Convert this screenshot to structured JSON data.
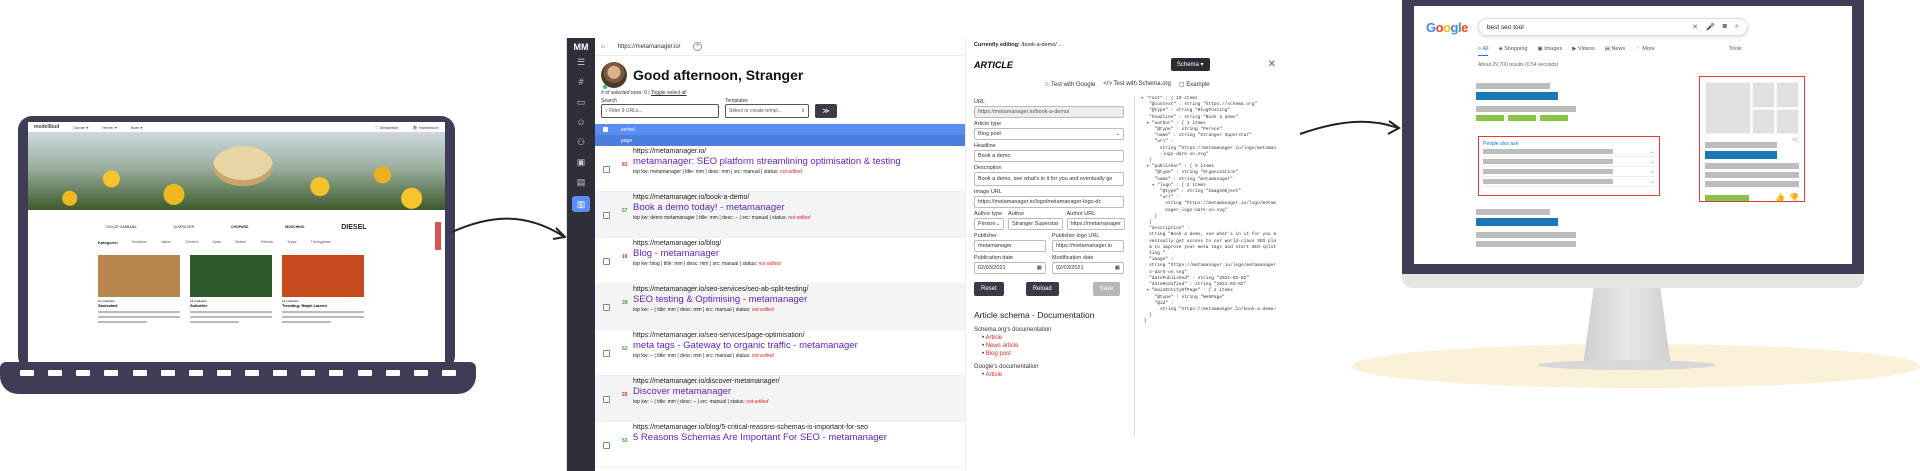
{
  "shop": {
    "logo": "modellbud",
    "nav": [
      "Damer ▾",
      "Herrer ▾",
      "Barn ▾"
    ],
    "actions": [
      "♡ Ønskeliste",
      "🛍 Handlekurv"
    ],
    "brands": [
      "DOLCE·GABBANA",
      "QUIKSILVER",
      "CHOPARD",
      "MOSCHINO",
      "DIESEL"
    ],
    "categories_title": "Kategorier",
    "categories": [
      "Sneakers",
      "Jakker",
      "Gensere",
      "Kjoler",
      "Bukser",
      "Tilbehør",
      "Toppe",
      "Treningsklær"
    ],
    "cards": [
      {
        "tag": "10 produkter",
        "title": "Skolestart",
        "color": "#b8864b"
      },
      {
        "tag": "15 produkter",
        "title": "Solbriller",
        "color": "#2e5a2a"
      },
      {
        "tag": "12 produkter",
        "title": "Trending: Ralph Lauren",
        "color": "#c4491c"
      }
    ]
  },
  "app": {
    "logo": "MM",
    "url": "https://metamanager.io/",
    "greeting": "Good afternoon, Stranger",
    "selected_rows": "# of selected rows: 0",
    "toggle_select_all": "Toggle select all",
    "search_label": "Search",
    "search_placeholder": "Filter 9 URLs...",
    "templates_label": "Templates",
    "templates_placeholder": "Select or create templ...",
    "go_label": "≫",
    "table_header": [
      "sorted",
      "page"
    ],
    "rows": [
      {
        "num": "81",
        "num_color": "#e02424",
        "url": "https://metamanager.io/",
        "title": "metamanager: SEO platform streamlining optimisation & testing",
        "meta": "top kw: metamanager | title: mm | desc: mm | src: manual | status:",
        "status": "not edited"
      },
      {
        "num": "57",
        "num_color": "#2e9e3e",
        "url": "https://metamanager.io/book-a-demo/",
        "title": "Book a demo today! - metamanager",
        "meta": "top kw: demo metamanager | title: mm | desc: – | src: manual | status:",
        "status": "not edited"
      },
      {
        "num": "16",
        "num_color": "#e02424",
        "url": "https://metamanager.io/blog/",
        "title": "Blog - metamanager",
        "meta": "top kw: blog | title: mm | desc: mm | src: manual | status:",
        "status": "not edited"
      },
      {
        "num": "39",
        "num_color": "#2e9e3e",
        "url": "https://metamanager.io/seo-services/seo-ab-split-testing/",
        "title": "SEO testing & Optimising - metamanager",
        "meta": "top kw: – | title: mm | desc: mm | src: manual | status:",
        "status": "not edited"
      },
      {
        "num": "52",
        "num_color": "#2e9e3e",
        "url": "https://metamanager.io/seo-services/page-optimisation/",
        "title": "meta tags - Gateway to organic traffic - metamanager",
        "meta": "top kw: – | title: mm | desc: mm | src: manual | status:",
        "status": "not edited"
      },
      {
        "num": "20",
        "num_color": "#e02424",
        "url": "https://metamanager.io/discover-metamanager/",
        "title": "Discover metamanager",
        "meta": "top kw: – | title: mm | desc: – | src: manual | status:",
        "status": "not edited"
      },
      {
        "num": "53",
        "num_color": "#2e9e3e",
        "url": "https://metamanager.io/blog/5-critical-reasons-schemas-is-important-for-seo",
        "title": "5 Reasons Schemas Are Important For SEO - metamanager",
        "meta": "",
        "status": ""
      }
    ],
    "editor": {
      "currently_label": "Currently editing:",
      "currently_value": "/book-a-demo/ ...",
      "type_title": "ARTICLE",
      "schema_button": "Schema ▾",
      "close": "✕",
      "links": [
        "☆ Test with Google",
        "</> Test with Schema.org",
        "▢ Example"
      ],
      "fields": {
        "url_label": "URL",
        "url_value": "https://metamanager.io/book-a-demo/",
        "article_type_label": "Article type",
        "article_type_value": "Blog post",
        "headline_label": "Headline",
        "headline_value": "Book a demo",
        "description_label": "Description",
        "description_value": "Book a demo, see what's in it for you and eventually ge",
        "image_label": "Image URL",
        "image_value": "https://metamanager.io/logo/metamanager-logo-dc",
        "author_type_label": "Author type",
        "author_type_value": "Person",
        "author_label": "Author",
        "author_value": "Stranger Superstar",
        "author_url_label": "Author URL",
        "author_url_value": "https://metamanager",
        "publisher_label": "Publisher",
        "publisher_value": "metamanager",
        "publisher_logo_label": "Publisher logo URL",
        "publisher_logo_value": "https://metamanager.io",
        "pub_date_label": "Publication date",
        "pub_date_value": "02/03/2021",
        "mod_date_label": "Modification date",
        "mod_date_value": "02/03/2021"
      },
      "buttons": {
        "reset": "Reset",
        "reload": "Reload",
        "save": "Save"
      },
      "doc_title": "Article schema - Documentation",
      "doc_schema_org": "Schema.org's documentation",
      "doc_schema_links": [
        "Article",
        "News article",
        "Blog post"
      ],
      "doc_google": "Google's documentation",
      "doc_google_links": [
        "Article"
      ],
      "json": "▾ \"root\" : { 10 items\n   \"@context\" : string \"https://schema.org\"\n   \"@type\" : string \"BlogPosting\"\n   \"headline\" : string \"Book a demo\"\n  ▾ \"author\" : { 3 items\n     \"@type\" : string \"Person\"\n     \"name\" : string \"Stranger Superstar\"\n     \"url\" :\n       string \"https://metamanager.io/logo/metamanager\n       -logo-dark-on.svg\"\n   }\n  ▾ \"publisher\" : { 3 items\n     \"@type\" : string \"Organization\"\n     \"name\" : string \"metamanager\"\n    ▾ \"logo\" : { 2 items\n       \"@type\" : string \"ImageObject\"\n       \"url\" :\n         string \"https://metamanager.io/logo/metama\n         nager-logo-dark-on.svg\"\n     }\n   }\n   \"description\" :\n   string \"Book a demo, see what's in it for you and e\n   ventually get access to our world-class SEO platfo\n   m to improve your meta tags and start SEO split tes\n   ting.\"\n   \"image\" :\n   string \"https://metamanager.io/logo/metamanager-log\n   o-dark-on.svg\"\n   \"datePublished\" : string \"2021-03-02\"\n   \"dateModified\" : string \"2021-03-02\"\n  ▾ \"mainEntityOfPage\" : { 2 items\n     \"@type\" : string \"WebPage\"\n     \"@id\" :\n       string \"https://metamanager.io/book-a-demo/\"\n   }\n }"
    }
  },
  "google": {
    "logo_letters": [
      {
        "ch": "G",
        "color": "#4285f4"
      },
      {
        "ch": "o",
        "color": "#ea4335"
      },
      {
        "ch": "o",
        "color": "#fbbc05"
      },
      {
        "ch": "g",
        "color": "#4285f4"
      },
      {
        "ch": "l",
        "color": "#34a853"
      },
      {
        "ch": "e",
        "color": "#ea4335"
      }
    ],
    "query": "best seo tool",
    "tabs": [
      "All",
      "Shopping",
      "Images",
      "Videos",
      "News",
      "More"
    ],
    "tools": "Tools",
    "results_count": "About 29,700 results (0.54 seconds)",
    "paa_title": "People also ask"
  }
}
